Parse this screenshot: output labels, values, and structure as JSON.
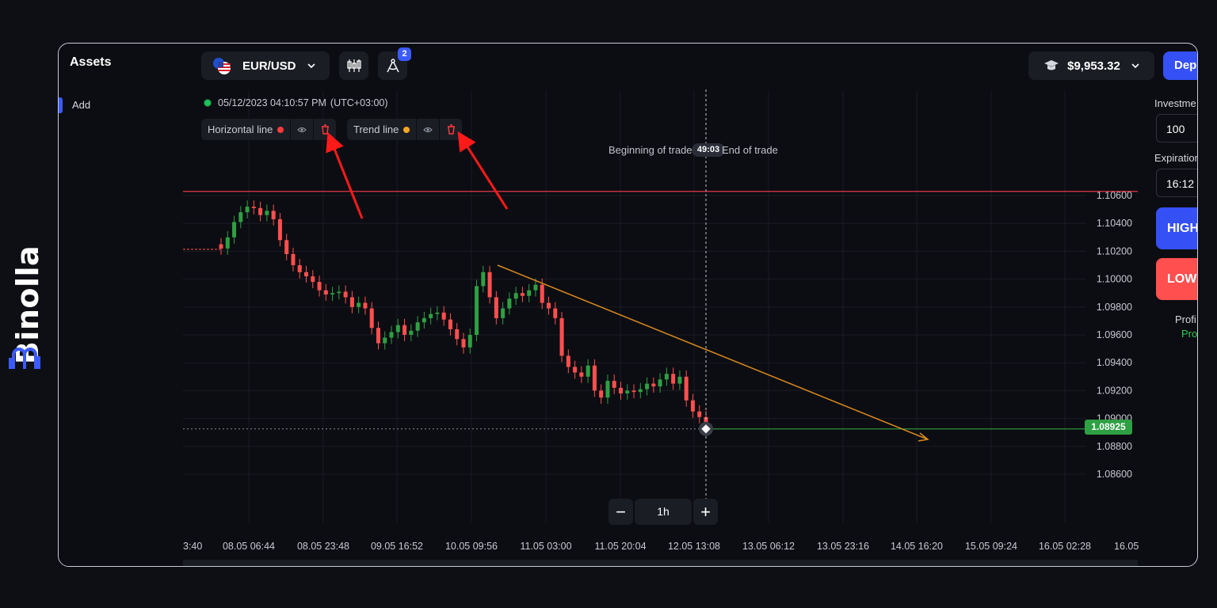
{
  "brand": {
    "name": "Binolla"
  },
  "sidebar": {
    "title": "Assets",
    "add_label": "Add"
  },
  "toolbar": {
    "pair": "EUR/USD",
    "drawings_count": "2",
    "balance": "$9,953.32",
    "deposit_label": "Dep"
  },
  "chart_header": {
    "timestamp": "05/12/2023 04:10:57 PM",
    "timezone": "(UTC+03:00)"
  },
  "drawing_tools": [
    {
      "label": "Horizontal line",
      "color": "#ff3b3b"
    },
    {
      "label": "Trend line",
      "color": "#f5a623"
    }
  ],
  "trade_markers": {
    "begin": "Beginning of trade",
    "timer": "49:03",
    "end": "End of trade"
  },
  "zoom": {
    "minus": "−",
    "timeframe": "1h",
    "plus": "+"
  },
  "trade_panel": {
    "investment_label": "Investme",
    "investment_value": "100",
    "expiration_label": "Expiration",
    "expiration_value": "16:12",
    "high_label": "HIGH",
    "low_label": "LOW",
    "profit_label": "Profi",
    "profit_value": "Pro"
  },
  "colors": {
    "accent": "#3550f5",
    "down": "#ff4f4f",
    "up": "#2ea043",
    "trend": "#d98a1f",
    "hline": "#e0394a"
  },
  "chart_data": {
    "type": "candlestick",
    "pair": "EUR/USD",
    "timeframe": "1h",
    "current_price": "1.08925",
    "ylim": [
      1.085,
      1.1075
    ],
    "y_ticks": [
      "1.10600",
      "1.10400",
      "1.10200",
      "1.10000",
      "1.09800",
      "1.09600",
      "1.09400",
      "1.09200",
      "1.09000",
      "1.08800",
      "1.08600"
    ],
    "x_ticks": [
      "3:40",
      "08.05 06:44",
      "08.05 23:48",
      "09.05 16:52",
      "10.05 09:56",
      "11.05 03:00",
      "11.05 20:04",
      "12.05 13:08",
      "13.05 06:12",
      "13.05 23:16",
      "14.05 16:20",
      "15.05 09:24",
      "16.05 02:28",
      "16.05"
    ],
    "horizontal_line": 1.1063,
    "trend_line": {
      "from": 1.101,
      "to": 1.0885
    },
    "close_series": [
      1.1022,
      1.103,
      1.1041,
      1.1048,
      1.1052,
      1.1051,
      1.1046,
      1.1049,
      1.1043,
      1.1028,
      1.1018,
      1.101,
      1.1005,
      1.1002,
      1.0998,
      1.0992,
      1.0989,
      1.099,
      1.0991,
      1.0987,
      1.098,
      1.0983,
      1.0979,
      1.0965,
      1.0954,
      1.0958,
      1.0962,
      1.0967,
      1.096,
      1.0963,
      1.0969,
      1.0972,
      1.0975,
      1.0976,
      1.0971,
      1.0964,
      1.0957,
      1.0951,
      1.096,
      1.0995,
      1.1005,
      1.0987,
      1.0972,
      1.0979,
      1.0986,
      1.099,
      1.0988,
      1.0992,
      1.0996,
      1.0983,
      1.0979,
      1.0972,
      1.0945,
      1.0937,
      1.0933,
      1.093,
      1.0938,
      1.092,
      1.0915,
      1.0927,
      1.0922,
      1.0918,
      1.092,
      1.0919,
      1.0921,
      1.0925,
      1.0923,
      1.0928,
      1.0932,
      1.0925,
      1.093,
      1.0913,
      1.0905,
      1.0901,
      1.08925
    ]
  }
}
